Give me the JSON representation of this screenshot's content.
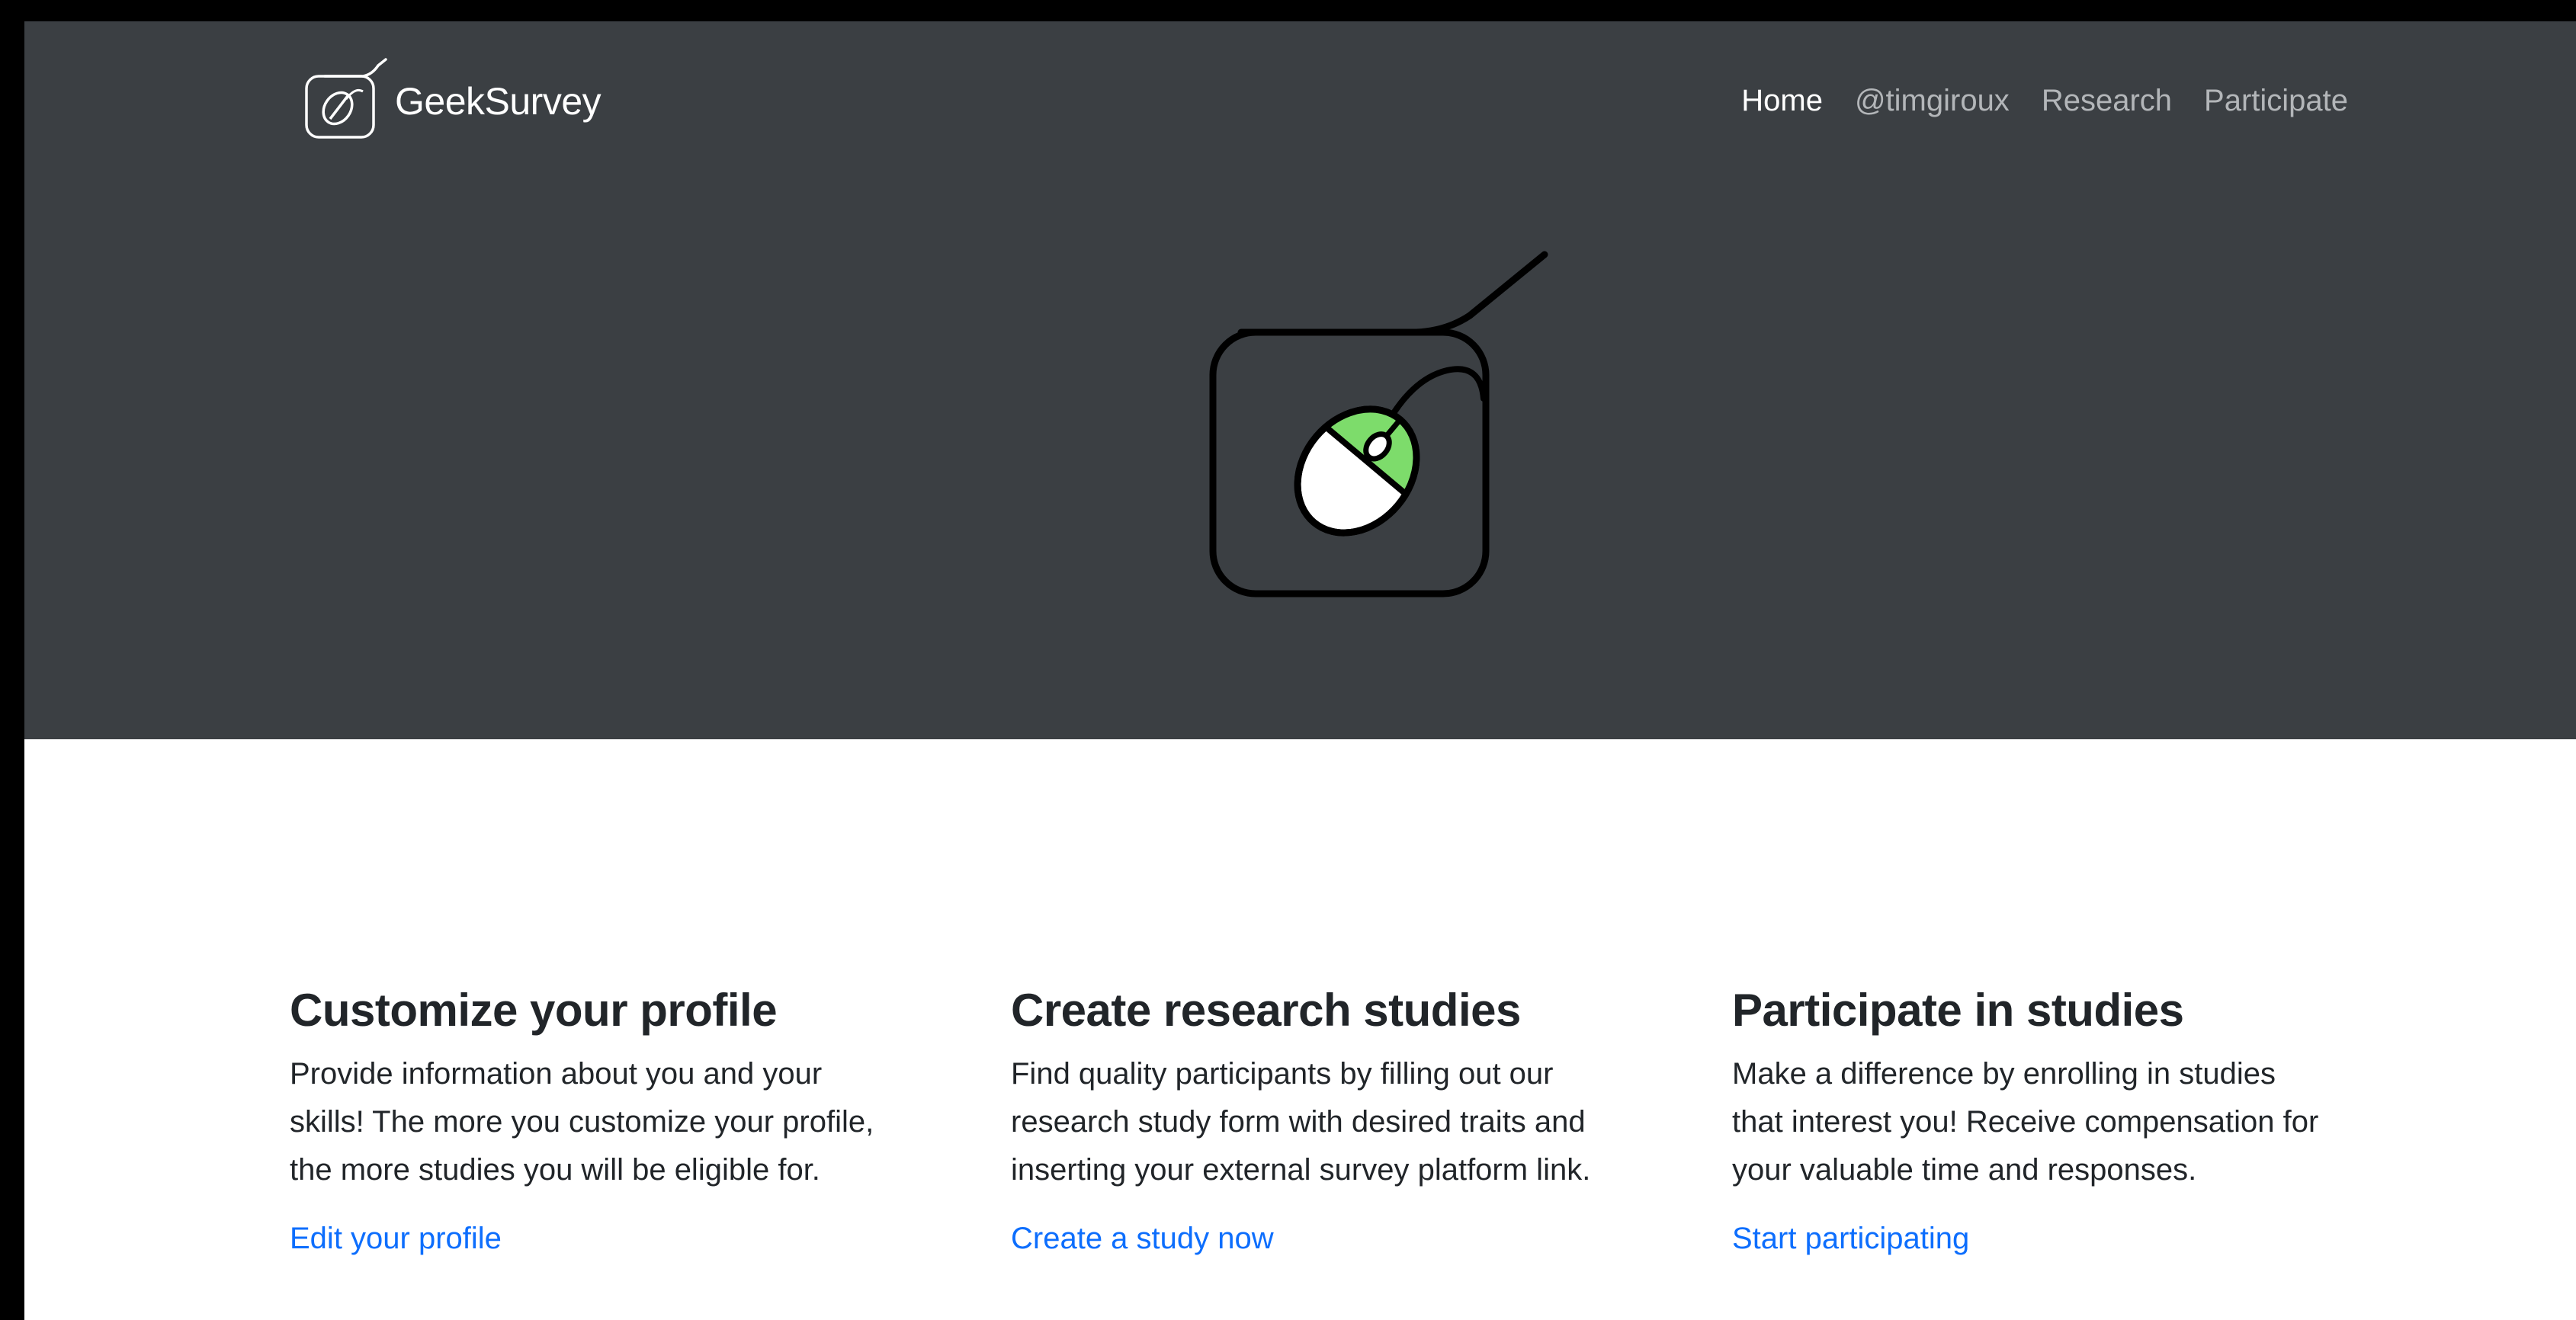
{
  "brand": {
    "name": "GeekSurvey",
    "logo_icon": "mouse-pad-icon"
  },
  "nav": {
    "items": [
      {
        "label": "Home",
        "active": true
      },
      {
        "label": "@timgiroux",
        "active": false
      },
      {
        "label": "Research",
        "active": false
      },
      {
        "label": "Participate",
        "active": false
      }
    ]
  },
  "hero": {
    "illustration_icon": "mouse-on-pad-icon"
  },
  "features": [
    {
      "title": "Customize your profile",
      "lines": [
        "Provide information about you and your",
        "skills! The more you customize your profile,",
        "the more studies you will be eligible for."
      ],
      "link": "Edit your profile"
    },
    {
      "title": "Create research studies",
      "lines": [
        "Find quality participants by filling out our",
        "research study form with desired traits and",
        "inserting your external survey platform link."
      ],
      "link": "Create a study now"
    },
    {
      "title": "Participate in studies",
      "lines": [
        "Make a difference by enrolling in studies",
        "that interest you! Receive compensation for",
        "your valuable time and responses."
      ],
      "link": "Start participating"
    }
  ],
  "colors": {
    "hero_background": "#3b3f43",
    "accent_green": "#7ddc6b",
    "link_blue": "#0d6efd",
    "nav_inactive": "#b3b6b9",
    "text_dark": "#212529"
  }
}
